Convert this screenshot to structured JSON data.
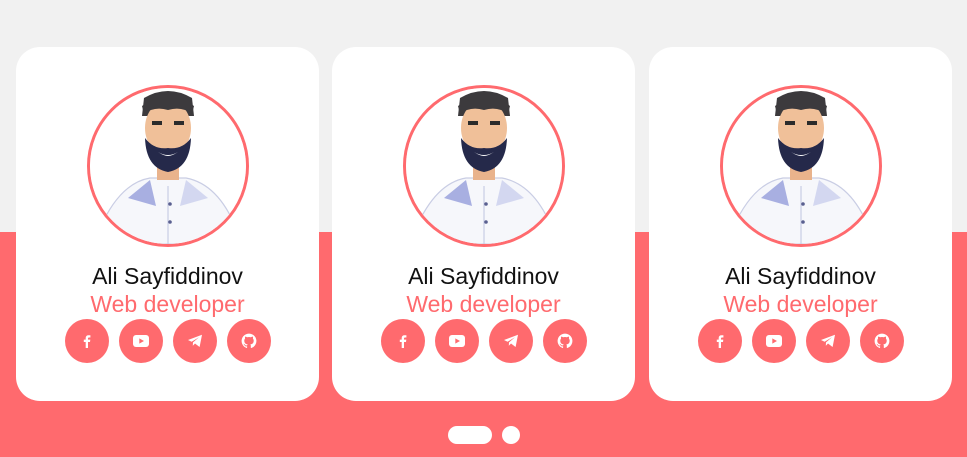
{
  "theme": {
    "accent": "#ff6a6e",
    "card_bg": "#ffffff",
    "page_bg_top": "#f1f1f1"
  },
  "cards": [
    {
      "name": "Ali Sayfiddinov",
      "role": "Web developer",
      "socials": [
        "facebook-icon",
        "youtube-icon",
        "telegram-icon",
        "github-icon"
      ]
    },
    {
      "name": "Ali Sayfiddinov",
      "role": "Web developer",
      "socials": [
        "facebook-icon",
        "youtube-icon",
        "telegram-icon",
        "github-icon"
      ]
    },
    {
      "name": "Ali Sayfiddinov",
      "role": "Web developer",
      "socials": [
        "facebook-icon",
        "youtube-icon",
        "telegram-icon",
        "github-icon"
      ]
    }
  ],
  "pagination": {
    "total": 2,
    "active": 1
  }
}
